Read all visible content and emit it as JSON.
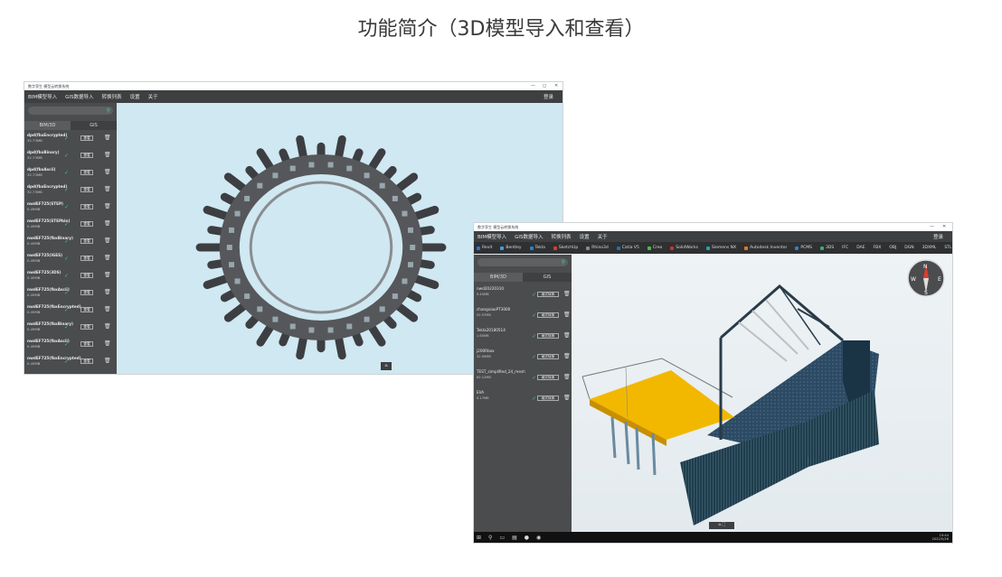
{
  "slide_title": "功能简介（3D模型导入和查看）",
  "window1": {
    "title": "数字孪生 模型云转换系统",
    "controls": [
      "—",
      "◻",
      "✕"
    ],
    "menu": [
      "BIM模型导入",
      "GIS数据导入",
      "转换列表",
      "设置",
      "关于"
    ],
    "menu_right": "登录",
    "tabs": [
      "BIM/3D",
      "GIS"
    ],
    "items": [
      {
        "name": "dpd(fbxEncrypted)",
        "size": "32.73MB",
        "btn": "查看"
      },
      {
        "name": "dpd(fbxBinary)",
        "size": "32.73MB",
        "btn": "查看"
      },
      {
        "name": "dpd(fbxAscii)",
        "size": "32.73MB",
        "btn": "查看"
      },
      {
        "name": "dpd(fbxEncrypted)",
        "size": "32.73MB",
        "btn": "查看"
      },
      {
        "name": "nwdEF725(STEP)",
        "size": "0.49MB",
        "btn": "查看"
      },
      {
        "name": "nwdEF725(STEPbin)",
        "size": "0.49MB",
        "btn": "查看"
      },
      {
        "name": "nwdEF725(fbxBinary)",
        "size": "0.49MB",
        "btn": "查看"
      },
      {
        "name": "nwdEF725(IGES)",
        "size": "0.49MB",
        "btn": "查看"
      },
      {
        "name": "nwdEF725(3DS)",
        "size": "0.49MB",
        "btn": "查看"
      },
      {
        "name": "nwdEF725(fbxAscii)",
        "size": "0.49MB",
        "btn": "查看"
      },
      {
        "name": "nwdEF725(fbxEncrypted)",
        "size": "0.49MB",
        "btn": "查看"
      },
      {
        "name": "nwdEF725(fbxBinary)",
        "size": "0.49MB",
        "btn": "查看"
      },
      {
        "name": "nwdEF725(fbxAscii)",
        "size": "0.49MB",
        "btn": "查看"
      },
      {
        "name": "nwdEF725(fbxEncrypted)",
        "size": "0.49MB",
        "btn": "查看"
      }
    ]
  },
  "window2": {
    "title": "数字孪生 模型云转换系统",
    "controls": [
      "—",
      "✕"
    ],
    "menu": [
      "BIM模型导入",
      "GIS数据导入",
      "转换列表",
      "设置",
      "关于"
    ],
    "menu_right": "登录",
    "toolbar": [
      {
        "label": "Revit",
        "color": "#2f6fd6"
      },
      {
        "label": "Bentley",
        "color": "#3aa0e0"
      },
      {
        "label": "Tekla",
        "color": "#2a82c8"
      },
      {
        "label": "SketchUp",
        "color": "#d83b2e"
      },
      {
        "label": "Rhino3d",
        "color": "#8a8a8a"
      },
      {
        "label": "Catia V5",
        "color": "#1e6fb8"
      },
      {
        "label": "Creo",
        "color": "#4fb848"
      },
      {
        "label": "SolidWorks",
        "color": "#d0302a"
      },
      {
        "label": "Siemens NX",
        "color": "#1fa3b3"
      },
      {
        "label": "Autodesk Inventor",
        "color": "#e07b1e"
      },
      {
        "label": "PCMS",
        "color": "#2e80c8"
      },
      {
        "label": "3DS",
        "color": "#3cab6c"
      },
      {
        "label": "IFC",
        "color": ""
      },
      {
        "label": "DAE",
        "color": ""
      },
      {
        "label": "FBX",
        "color": ""
      },
      {
        "label": "OBJ",
        "color": ""
      },
      {
        "label": "DGN",
        "color": ""
      },
      {
        "label": "3DXML",
        "color": ""
      },
      {
        "label": "STL",
        "color": ""
      }
    ],
    "tabs": [
      "BIM/3D",
      "GIS"
    ],
    "items": [
      {
        "name": "nwd20220310",
        "size": "9.45MB",
        "btn": "格式转换"
      },
      {
        "name": "changxiaoPT3000",
        "size": "52.97MB",
        "btn": "格式转换"
      },
      {
        "name": "Tekla20180514",
        "size": "1.65MB",
        "btn": "格式转换"
      },
      {
        "name": "j200Rbox",
        "size": "32.09MB",
        "btn": "格式转换"
      },
      {
        "name": "TEST_simplified_24_mesh",
        "size": "62.12MB",
        "btn": "格式转换"
      },
      {
        "name": "EVA",
        "size": "0.17MB",
        "btn": "格式转换"
      }
    ],
    "taskbar_time": "19:44",
    "taskbar_date": "2022/5/26"
  }
}
